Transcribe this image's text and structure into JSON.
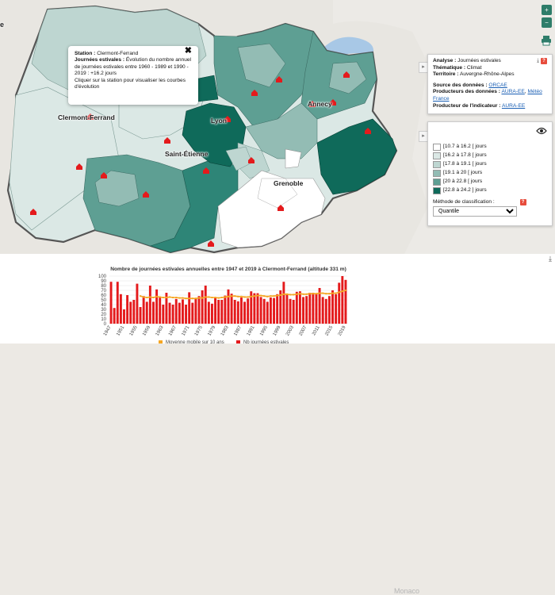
{
  "map": {
    "places": {
      "clermont": "Clermont-Ferrand",
      "lyon": "Lyon",
      "saint_etienne": "Saint-Étienne",
      "annecy": "Annecy",
      "grenoble": "Grenoble",
      "edge_left": "e",
      "monaco": "Monaco"
    },
    "popup": {
      "station_label": "Station :",
      "station_value": "Clermont-Ferrand",
      "indicator_label": "Journées estivales :",
      "indicator_value": "Évolution du nombre annuel de journées estivales entre 1960 - 1989 et 1990 - 2019 : +16.2 jours",
      "hint": "Cliquer sur la station pour visualiser les courbes d'évolution",
      "close_symbol": "✖"
    },
    "zoom_in": "+",
    "zoom_out": "−",
    "colors": {
      "darkest": "#0f6a5a",
      "dark": "#2e8577",
      "mid": "#5e9f93",
      "light": "#93bcb4",
      "lighter": "#bed6d1",
      "lightest": "#dbe8e5",
      "white": "#ffffff"
    }
  },
  "info_panel": {
    "analyse_label": "Analyse :",
    "analyse_value": "Journées estivales",
    "thematique_label": "Thématique :",
    "thematique_value": "Climat",
    "territoire_label": "Territoire :",
    "territoire_value": "Auvergne-Rhône-Alpes",
    "source_label": "Source des données :",
    "source_value": "ORCAE",
    "producteurs_label": "Producteurs des données :",
    "producteurs_value_1": "AURA-EE",
    "producteurs_sep": ",",
    "producteurs_value_2": "Météo France",
    "producteur_ind_label": "Producteur de l'indicateur :",
    "producteur_ind_value": "AURA-EE",
    "help": "?"
  },
  "legend": {
    "items": [
      {
        "label": "[10.7 à 16.2 [ jours",
        "color": "#ffffff"
      },
      {
        "label": "[16.2 à 17.8 [ jours",
        "color": "#dbe8e5"
      },
      {
        "label": "[17.8 à 19.1 [ jours",
        "color": "#bed6d1"
      },
      {
        "label": "[19.1 à 20 [ jours",
        "color": "#93bcb4"
      },
      {
        "label": "[20 à 22.8 [ jours",
        "color": "#5e9f93"
      },
      {
        "label": "[22.8 à 24.2 ] jours",
        "color": "#0f6a5a"
      }
    ],
    "method_label": "Méthode de classification :",
    "method_value": "Quantile",
    "help": "?"
  },
  "chart_data": {
    "type": "bar",
    "title": "Nombre de journées estivales annuelles entre 1947 et 2019 à Clermont-Ferrand (altitude 331 m)",
    "ylim": [
      0,
      100
    ],
    "yticks": [
      0,
      10,
      20,
      30,
      40,
      50,
      60,
      70,
      80,
      90,
      100
    ],
    "xtick_labels": [
      "1947",
      "1951",
      "1955",
      "1959",
      "1963",
      "1967",
      "1971",
      "1975",
      "1979",
      "1983",
      "1987",
      "1991",
      "1995",
      "1999",
      "2003",
      "2007",
      "2011",
      "2015",
      "2019"
    ],
    "years_start": 1947,
    "values": [
      88,
      33,
      88,
      62,
      30,
      60,
      46,
      50,
      84,
      35,
      58,
      46,
      80,
      46,
      72,
      56,
      40,
      65,
      44,
      40,
      52,
      44,
      51,
      40,
      66,
      44,
      52,
      58,
      70,
      80,
      46,
      42,
      54,
      50,
      50,
      59,
      72,
      63,
      50,
      47,
      55,
      46,
      53,
      68,
      64,
      64,
      56,
      52,
      46,
      55,
      54,
      62,
      70,
      88,
      62,
      52,
      50,
      67,
      68,
      56,
      58,
      65,
      65,
      63,
      75,
      56,
      52,
      58,
      70,
      62,
      86,
      100,
      92
    ],
    "moving_avg": [
      null,
      null,
      null,
      null,
      null,
      null,
      null,
      null,
      null,
      58,
      56,
      55,
      56,
      55,
      57,
      56,
      55,
      55,
      56,
      55,
      55,
      54,
      54,
      53,
      53,
      53,
      53,
      54,
      54,
      56,
      56,
      55,
      55,
      54,
      55,
      56,
      57,
      58,
      58,
      57,
      57,
      56,
      56,
      57,
      58,
      59,
      59,
      58,
      57,
      58,
      58,
      59,
      60,
      62,
      62,
      61,
      61,
      62,
      63,
      62,
      62,
      63,
      63,
      63,
      64,
      64,
      63,
      63,
      64,
      64,
      66,
      68,
      70
    ],
    "series": [
      {
        "name": "Moyenne mobile sur 10 ans",
        "color": "#f5a623"
      },
      {
        "name": "Nb journées estivales",
        "color": "#e41a1c"
      }
    ]
  }
}
